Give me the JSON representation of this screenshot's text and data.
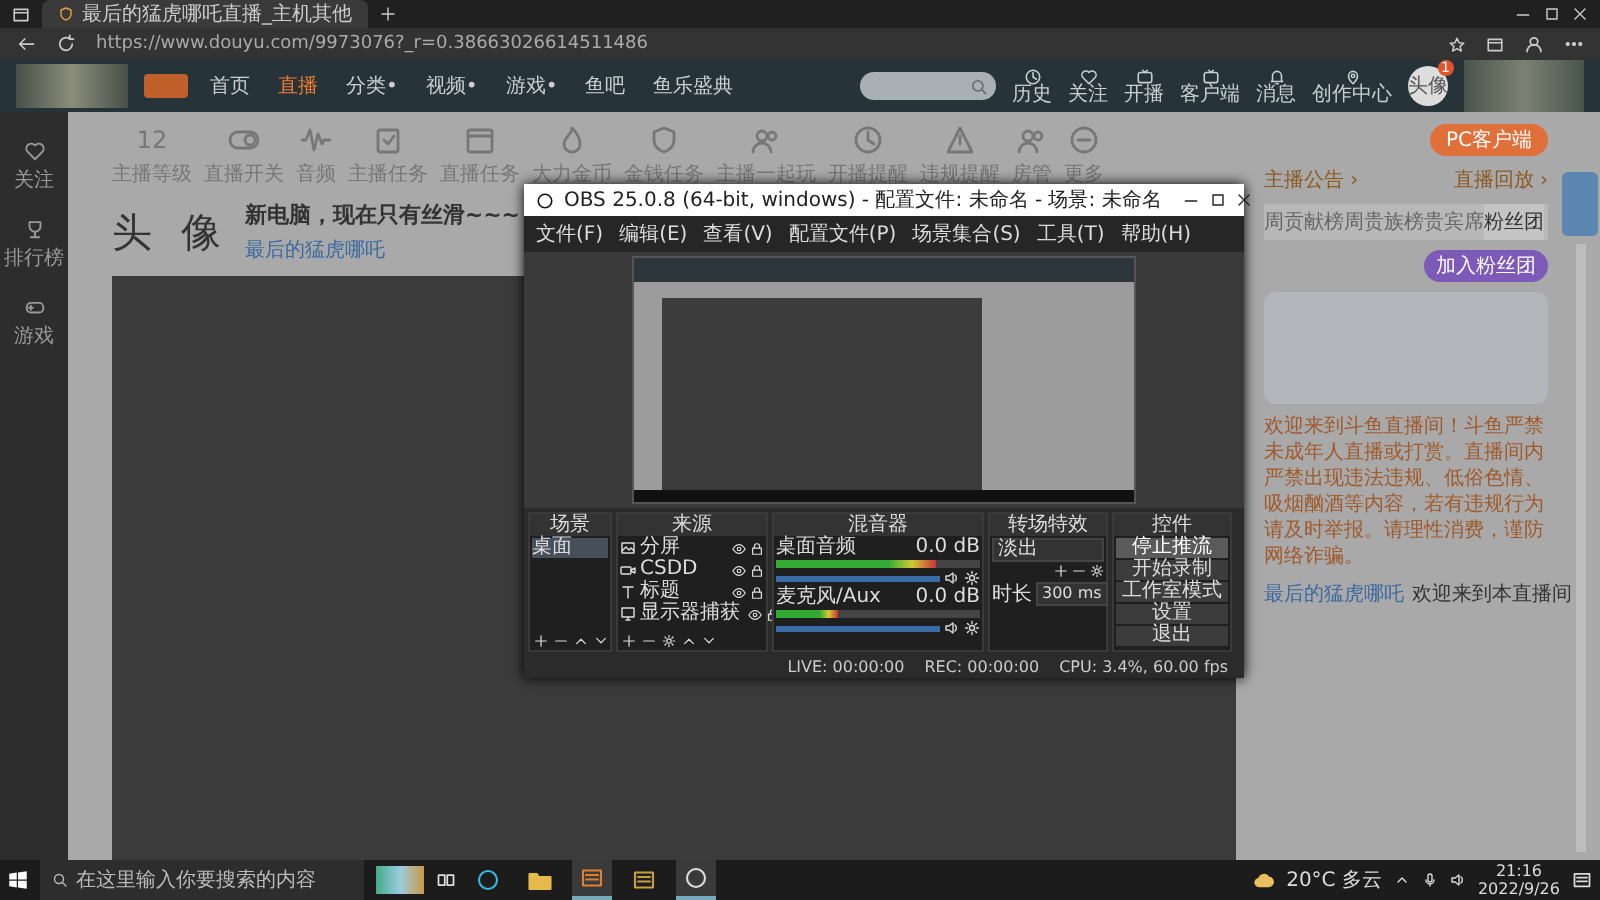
{
  "browser": {
    "tab_title": "最后的猛虎哪吒直播_主机其他",
    "url": "https://www.douyu.com/9973076?_r=0.38663026614511486"
  },
  "site_header": {
    "nav": [
      {
        "label": "首页",
        "selected": false
      },
      {
        "label": "直播",
        "selected": true
      },
      {
        "label": "分类•",
        "selected": false
      },
      {
        "label": "视频•",
        "selected": false
      },
      {
        "label": "游戏•",
        "selected": false
      },
      {
        "label": "鱼吧",
        "selected": false
      },
      {
        "label": "鱼乐盛典",
        "selected": false
      }
    ],
    "actions": [
      "历史",
      "关注",
      "开播",
      "客户端",
      "消息",
      "创作中心"
    ],
    "avatar": "头像",
    "badge": "1"
  },
  "sidebar": [
    "关注",
    "排行榜",
    "游戏"
  ],
  "tools": [
    {
      "label": "主播等级",
      "value": "12"
    },
    {
      "label": "直播开关"
    },
    {
      "label": "音频"
    },
    {
      "label": "主播任务"
    },
    {
      "label": "直播任务"
    },
    {
      "label": "大力金币"
    },
    {
      "label": "金钱任务"
    },
    {
      "label": "主播一起玩"
    },
    {
      "label": "开播提醒"
    },
    {
      "label": "违规提醒"
    },
    {
      "label": "房管"
    },
    {
      "label": "更多"
    }
  ],
  "room": {
    "avatar": "头 像",
    "title": "新电脑，现在只有丝滑~~~",
    "streamer": "最后的猛虎哪吒"
  },
  "side_panel": {
    "pc_button": "PC客户端",
    "links": [
      "主播公告 ›",
      "直播回放 ›"
    ],
    "tabs": [
      {
        "label": "周贡献榜",
        "selected": false
      },
      {
        "label": "周贵族榜",
        "selected": false
      },
      {
        "label": "贵宾席",
        "selected": false
      },
      {
        "label": "粉丝团",
        "selected": true
      }
    ],
    "join_button": "加入粉丝团",
    "notice": "欢迎来到斗鱼直播间！斗鱼严禁未成年人直播或打赏。直播间内严禁出现违法违规、低俗色情、吸烟酗酒等内容，若有违规行为请及时举报。请理性消费，谨防网络诈骗。",
    "user_link": "最后的猛虎哪吒",
    "welcome": "欢迎来到本直播间"
  },
  "obs": {
    "title": "OBS 25.0.8 (64-bit, windows) - 配置文件: 未命名 - 场景: 未命名",
    "menu": [
      "文件(F)",
      "编辑(E)",
      "查看(V)",
      "配置文件(P)",
      "场景集合(S)",
      "工具(T)",
      "帮助(H)"
    ],
    "docks": [
      "场景",
      "来源",
      "混音器",
      "转场特效",
      "控件"
    ],
    "scenes": [
      {
        "label": "桌面",
        "selected": true
      }
    ],
    "sources": [
      {
        "label": "分屏",
        "kind": "image"
      },
      {
        "label": "CSDD",
        "kind": "camera"
      },
      {
        "label": "标题",
        "kind": "text"
      },
      {
        "label": "显示器捕获",
        "kind": "display"
      }
    ],
    "mixer": [
      {
        "name": "桌面音频",
        "reading": "0.0 dB",
        "level": 0.78,
        "volume": {
          "level": 1
        }
      },
      {
        "name": "麦克风/Aux",
        "reading": "0.0 dB",
        "level": 0.3,
        "volume": {
          "level": 1
        }
      }
    ],
    "transition": {
      "type": "淡出",
      "duration_label": "时长",
      "duration": "300 ms"
    },
    "controls": [
      {
        "label": "停止推流",
        "active": true
      },
      {
        "label": "开始录制",
        "active": false
      },
      {
        "label": "工作室模式",
        "active": false
      },
      {
        "label": "设置",
        "active": false
      },
      {
        "label": "退出",
        "active": false
      }
    ],
    "status": [
      "LIVE: 00:00:00",
      "REC: 00:00:00",
      "CPU: 3.4%, 60.00 fps"
    ]
  },
  "taskbar": {
    "search_placeholder": "在这里输入你要搜索的内容",
    "apps": [
      {
        "kind": "edge",
        "active": false
      },
      {
        "kind": "folder",
        "active": false
      },
      {
        "kind": "app",
        "active": true
      },
      {
        "kind": "app2",
        "active": false
      },
      {
        "kind": "obs",
        "active": true
      }
    ],
    "weather": "20°C 多云",
    "time": "21:16",
    "date": "2022/9/26"
  }
}
